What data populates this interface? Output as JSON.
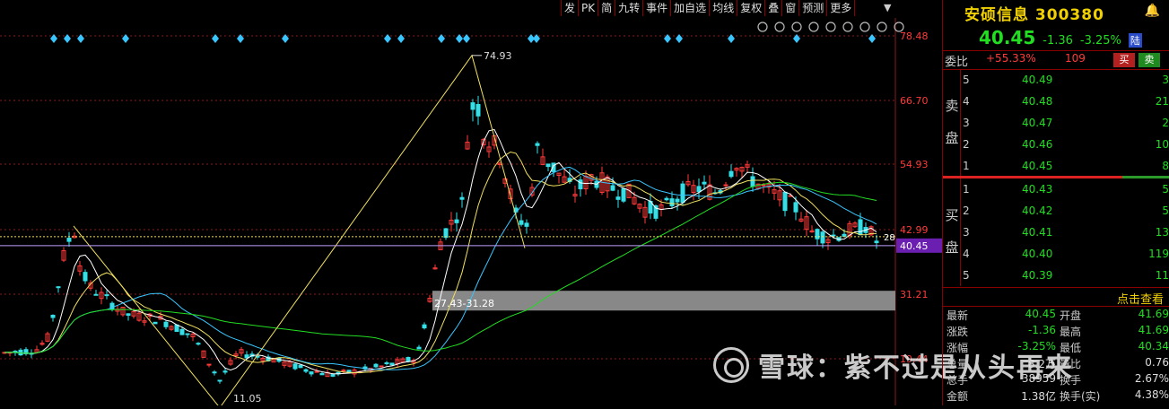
{
  "toolbar": {
    "items": [
      "发",
      "PK",
      "简",
      "九转",
      "事件",
      "加自选",
      "均线",
      "复权",
      "叠",
      "窗",
      "预测",
      "更多"
    ]
  },
  "chart": {
    "y_axis_labels": [
      "78.48",
      "66.70",
      "54.93",
      "42.99",
      "31.21",
      "19.44"
    ],
    "current_price_tag": "40.45",
    "current_price_right": "28",
    "high_marker": "74.93",
    "low_marker": "11.05",
    "gap_band_label": "27.43-31.28",
    "colors": {
      "up": "#ff3b3b",
      "down": "#33e0e8",
      "ma5": "#ffffff",
      "ma10": "#f0e060",
      "ma20": "#39c6ff",
      "ma60": "#22dd22",
      "price_line": "#c0a0ff"
    }
  },
  "watermark": {
    "text": "雪球：紫不过是从头再来"
  },
  "quote": {
    "name": "安硕信息",
    "code": "300380",
    "price": "40.45",
    "change": "-1.36",
    "change_pct": "-3.25%",
    "market_badge": "陆",
    "ratio_label": "委比",
    "ratio_pct": "+55.33%",
    "ratio_val": "109",
    "buy_label": "买",
    "sell_label": "卖"
  },
  "order_book": {
    "sell_label": "卖盘",
    "buy_label": "买盘",
    "sells": [
      {
        "level": "5",
        "price": "40.49",
        "volume": "3"
      },
      {
        "level": "4",
        "price": "40.48",
        "volume": "21"
      },
      {
        "level": "3",
        "price": "40.47",
        "volume": "2"
      },
      {
        "level": "2",
        "price": "40.46",
        "volume": "10"
      },
      {
        "level": "1",
        "price": "40.45",
        "volume": "8"
      }
    ],
    "buys": [
      {
        "level": "1",
        "price": "40.43",
        "volume": "5"
      },
      {
        "level": "2",
        "price": "40.42",
        "volume": "5"
      },
      {
        "level": "3",
        "price": "40.41",
        "volume": "13"
      },
      {
        "level": "4",
        "price": "40.40",
        "volume": "119"
      },
      {
        "level": "5",
        "price": "40.39",
        "volume": "11"
      }
    ],
    "click_view": "点击查看"
  },
  "stats": [
    {
      "l": "最新",
      "lv": "40.45",
      "r": "开盘",
      "rv": "41.69"
    },
    {
      "l": "涨跌",
      "lv": "-1.36",
      "r": "最高",
      "rv": "41.69"
    },
    {
      "l": "涨幅",
      "lv": "-3.25%",
      "r": "最低",
      "rv": "40.34"
    },
    {
      "l": "总量",
      "lv": "8.2万",
      "r": "量比",
      "rv": "0.76"
    },
    {
      "l": "总手",
      "lv": "38959",
      "r": "换手",
      "rv": "2.67%"
    },
    {
      "l": "金额",
      "lv": "1.38亿",
      "r": "换手(实)",
      "rv": "4.38%"
    }
  ]
}
